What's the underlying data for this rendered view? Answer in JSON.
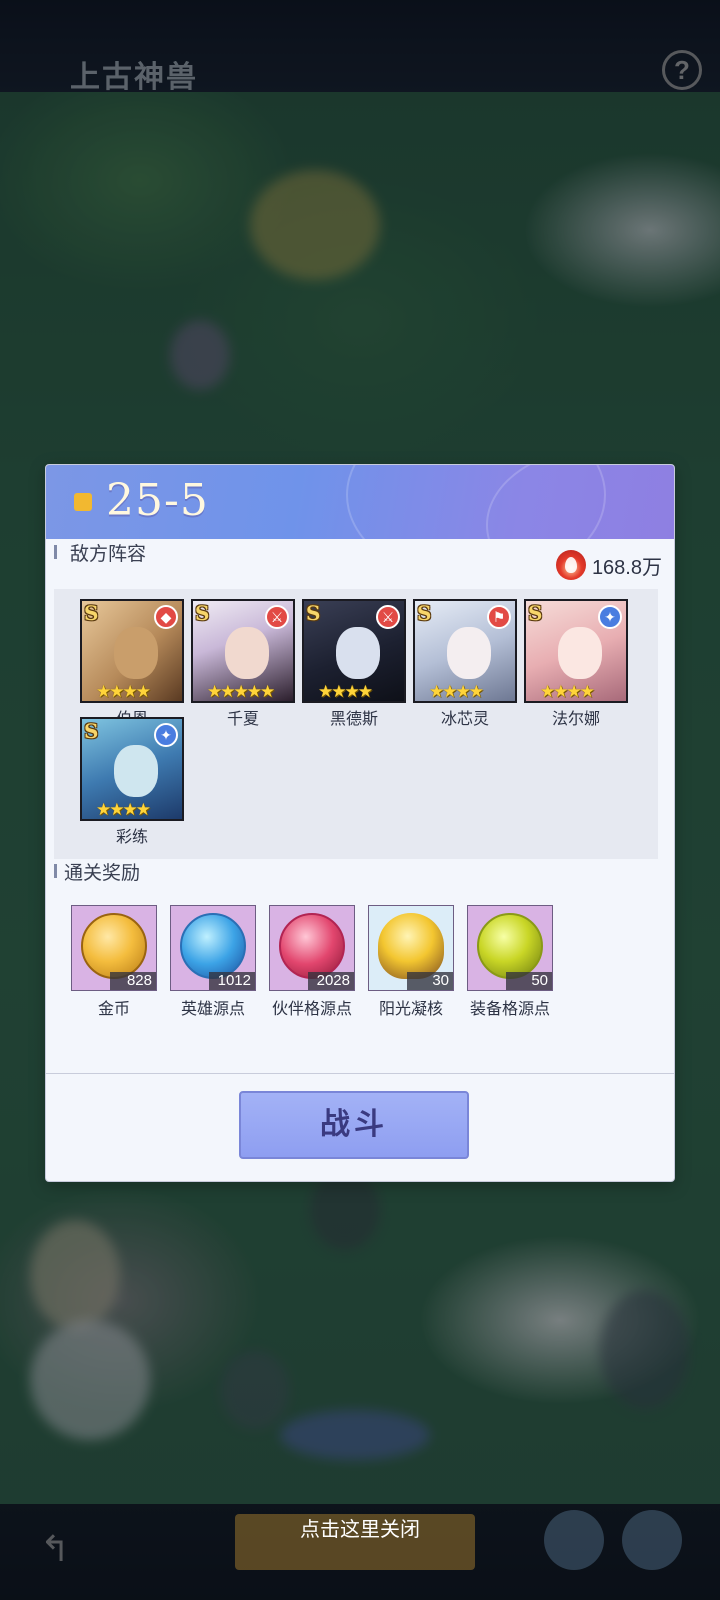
{
  "background": {
    "top_title": "上古神兽"
  },
  "dialog": {
    "stage": "25-5",
    "enemy_section_label": "敌方阵容",
    "power_value": "168.8万",
    "enemies": [
      {
        "name": "伯恩",
        "grade": "S",
        "stars": "★★★★",
        "class_icon": "shield-icon",
        "class_color": "#e24a45"
      },
      {
        "name": "千夏",
        "grade": "S",
        "stars": "★★★★★",
        "class_icon": "sword-icon",
        "class_color": "#e24a45"
      },
      {
        "name": "黑德斯",
        "grade": "S",
        "stars": "★★★★",
        "class_icon": "sword-icon",
        "class_color": "#e24a45"
      },
      {
        "name": "冰芯灵",
        "grade": "S",
        "stars": "★★★★",
        "class_icon": "staff-icon",
        "class_color": "#e24a45"
      },
      {
        "name": "法尔娜",
        "grade": "S",
        "stars": "★★★★",
        "class_icon": "magic-icon",
        "class_color": "#4a7de0"
      },
      {
        "name": "彩练",
        "grade": "S",
        "stars": "★★★★",
        "class_icon": "magic-icon",
        "class_color": "#4a7de0"
      }
    ],
    "reward_section_label": "通关奖励",
    "rewards": [
      {
        "name": "金币",
        "qty": "828",
        "icon": "gold-coin-icon"
      },
      {
        "name": "英雄源点",
        "qty": "1012",
        "icon": "hero-essence-icon"
      },
      {
        "name": "伙伴格源点",
        "qty": "2028",
        "icon": "partner-essence-icon"
      },
      {
        "name": "阳光凝核",
        "qty": "30",
        "icon": "sunlight-core-icon"
      },
      {
        "name": "装备格源点",
        "qty": "50",
        "icon": "equipment-essence-icon"
      }
    ],
    "battle_label": "战斗"
  },
  "close_hint": "点击这里关闭"
}
